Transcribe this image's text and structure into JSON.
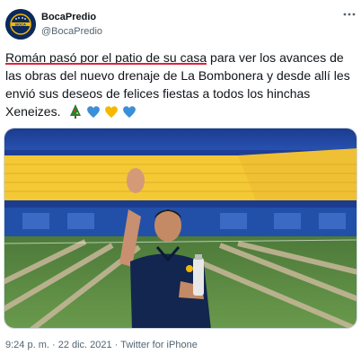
{
  "author": {
    "name": "BocaPredio",
    "handle": "@BocaPredio",
    "avatar_text": "BOCA"
  },
  "tweet": {
    "highlighted": "Román pasó por el patio de su casa",
    "text_rest": " para ver los avances de las obras del nuevo drenaje de La Bombonera y desde allí les envió sus deseos de felices fiestas a todos los hinchas Xeneizes.",
    "emojis": [
      "christmas-tree",
      "blue-heart",
      "yellow-heart",
      "blue-heart"
    ]
  },
  "footer": {
    "time": "9:24 p. m.",
    "separator": " · ",
    "date": "22 dic. 2021",
    "source": "Twitter for iPhone"
  },
  "colors": {
    "accent_underline": "#e0203a",
    "boca_blue": "#0b2a5b",
    "boca_yellow": "#f2b705"
  }
}
